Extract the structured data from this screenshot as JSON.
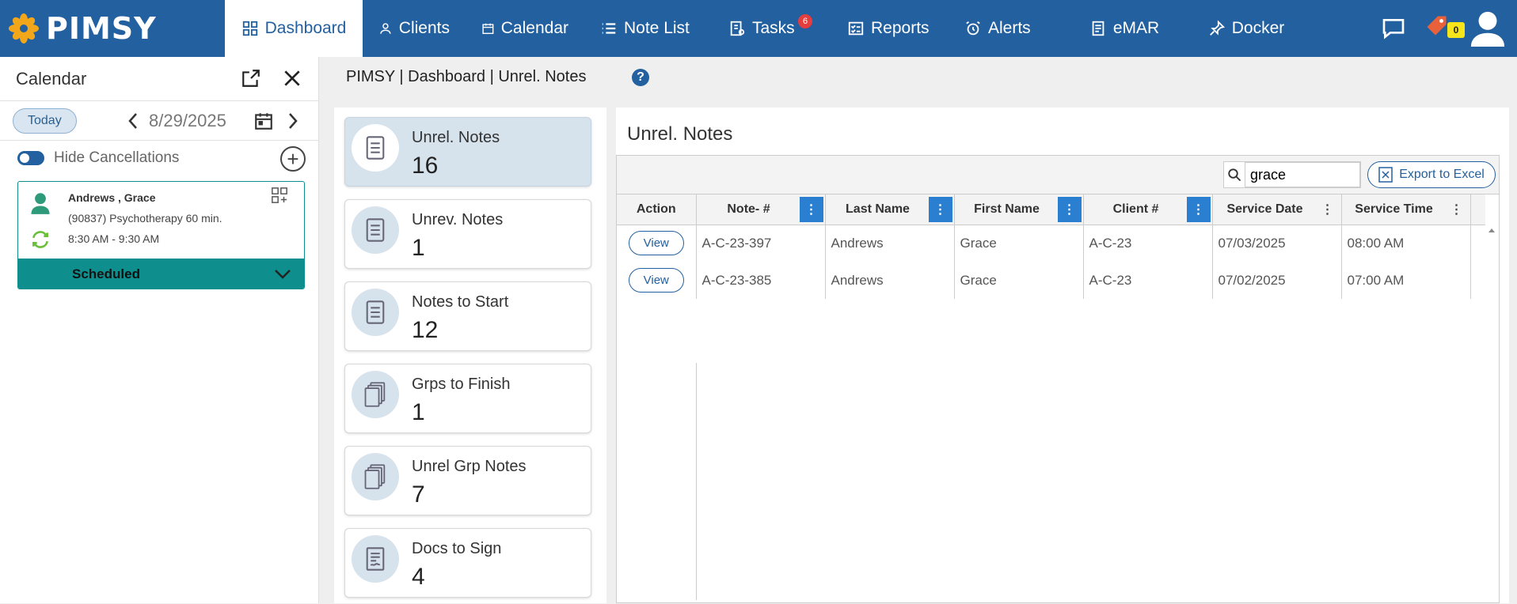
{
  "brand": {
    "name": "PIMSY"
  },
  "nav": {
    "items": [
      {
        "label": "Dashboard",
        "icon": "dashboard-icon"
      },
      {
        "label": "Clients",
        "icon": "person-icon"
      },
      {
        "label": "Calendar",
        "icon": "calendar-icon"
      },
      {
        "label": "Note List",
        "icon": "list-icon"
      },
      {
        "label": "Tasks",
        "icon": "tasks-icon",
        "badge": "6"
      },
      {
        "label": "Reports",
        "icon": "reports-icon"
      },
      {
        "label": "Alerts",
        "icon": "alarm-icon"
      },
      {
        "label": "eMAR",
        "icon": "emar-icon"
      },
      {
        "label": "Docker",
        "icon": "pin-icon"
      }
    ],
    "notification_count": "0"
  },
  "calendar": {
    "title": "Calendar",
    "today_label": "Today",
    "date": "8/29/2025",
    "hide_cancellations_label": "Hide Cancellations",
    "appointment": {
      "client": "Andrews , Grace",
      "service": "(90837) Psychotherapy 60 min.",
      "time": "8:30 AM - 9:30 AM",
      "status": "Scheduled"
    }
  },
  "breadcrumb": "PIMSY | Dashboard | Unrel. Notes",
  "tiles": [
    {
      "label": "Unrel. Notes",
      "count": "16",
      "icon": "note-icon"
    },
    {
      "label": "Unrev. Notes",
      "count": "1",
      "icon": "note-icon"
    },
    {
      "label": "Notes to Start",
      "count": "12",
      "icon": "note-icon"
    },
    {
      "label": "Grps to Finish",
      "count": "1",
      "icon": "group-notes-icon"
    },
    {
      "label": "Unrel Grp Notes",
      "count": "7",
      "icon": "group-notes-icon"
    },
    {
      "label": "Docs to Sign",
      "count": "4",
      "icon": "sign-doc-icon"
    }
  ],
  "main": {
    "title": "Unrel. Notes",
    "search_value": "grace",
    "export_label": "Export to Excel",
    "columns": [
      "Action",
      "Note- #",
      "Last Name",
      "First Name",
      "Client #",
      "Service Date",
      "Service Time"
    ],
    "rows": [
      {
        "action": "View",
        "note": "A-C-23-397",
        "last": "Andrews",
        "first": "Grace",
        "client": "A-C-23",
        "date": "07/03/2025",
        "time": "08:00 AM"
      },
      {
        "action": "View",
        "note": "A-C-23-385",
        "last": "Andrews",
        "first": "Grace",
        "client": "A-C-23",
        "date": "07/02/2025",
        "time": "07:00 AM"
      }
    ]
  },
  "colors": {
    "primary": "#2360a0",
    "teal": "#0f8e8e",
    "kebab": "#2a7fd1",
    "badge": "#e43d3d"
  }
}
